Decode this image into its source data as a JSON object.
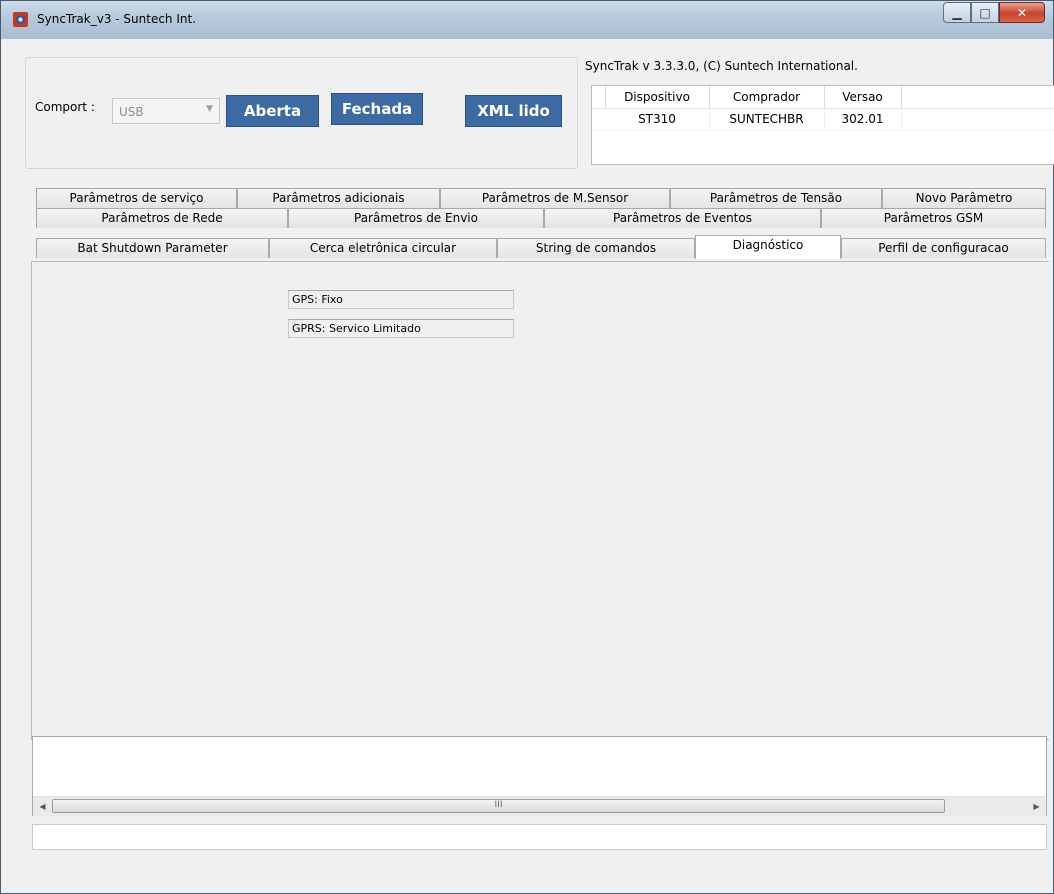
{
  "window": {
    "title": "SyncTrak_v3 - Suntech Int.",
    "icons": {
      "app": "app-logo-icon",
      "min": "minimize-icon",
      "max": "maximize-icon",
      "close": "close-icon"
    }
  },
  "connection": {
    "comport_label": "Comport :",
    "comport_value": "USB",
    "open_label": "Aberta",
    "close_label": "Fechada",
    "xml_label": "XML lido"
  },
  "version_text": "SyncTrak v 3.3.3.0, (C) Suntech International.",
  "device_table": {
    "headers": [
      "Dispositivo",
      "Comprador",
      "Versao"
    ],
    "rows": [
      [
        "ST310",
        "SUNTECHBR",
        "302.01"
      ]
    ]
  },
  "tabs": {
    "row1": [
      "Parâmetros de serviço",
      "Parâmetros adicionais",
      "Parâmetros  de M.Sensor",
      "Parâmetros de Tensão",
      "Novo Parâmetro"
    ],
    "row2": [
      "Parâmetros de Rede",
      "Parâmetros de Envio",
      "Parâmetros de Eventos",
      "Parâmetros GSM"
    ],
    "row3": [
      "Bat Shutdown Parameter",
      "Cerca eletrônica circular",
      "String de comandos",
      "Diagnóstico",
      "Perfil de configuracao"
    ],
    "active": "Diagnóstico"
  },
  "diagnostico": {
    "gps_status": "GPS: Fixo",
    "gprs_status": "GPRS: Servico Limitado"
  },
  "scrollbar": {
    "thumb_grip": "III"
  },
  "colors": {
    "button_blue": "#3d6aa3",
    "background": "#f0f0f0"
  }
}
